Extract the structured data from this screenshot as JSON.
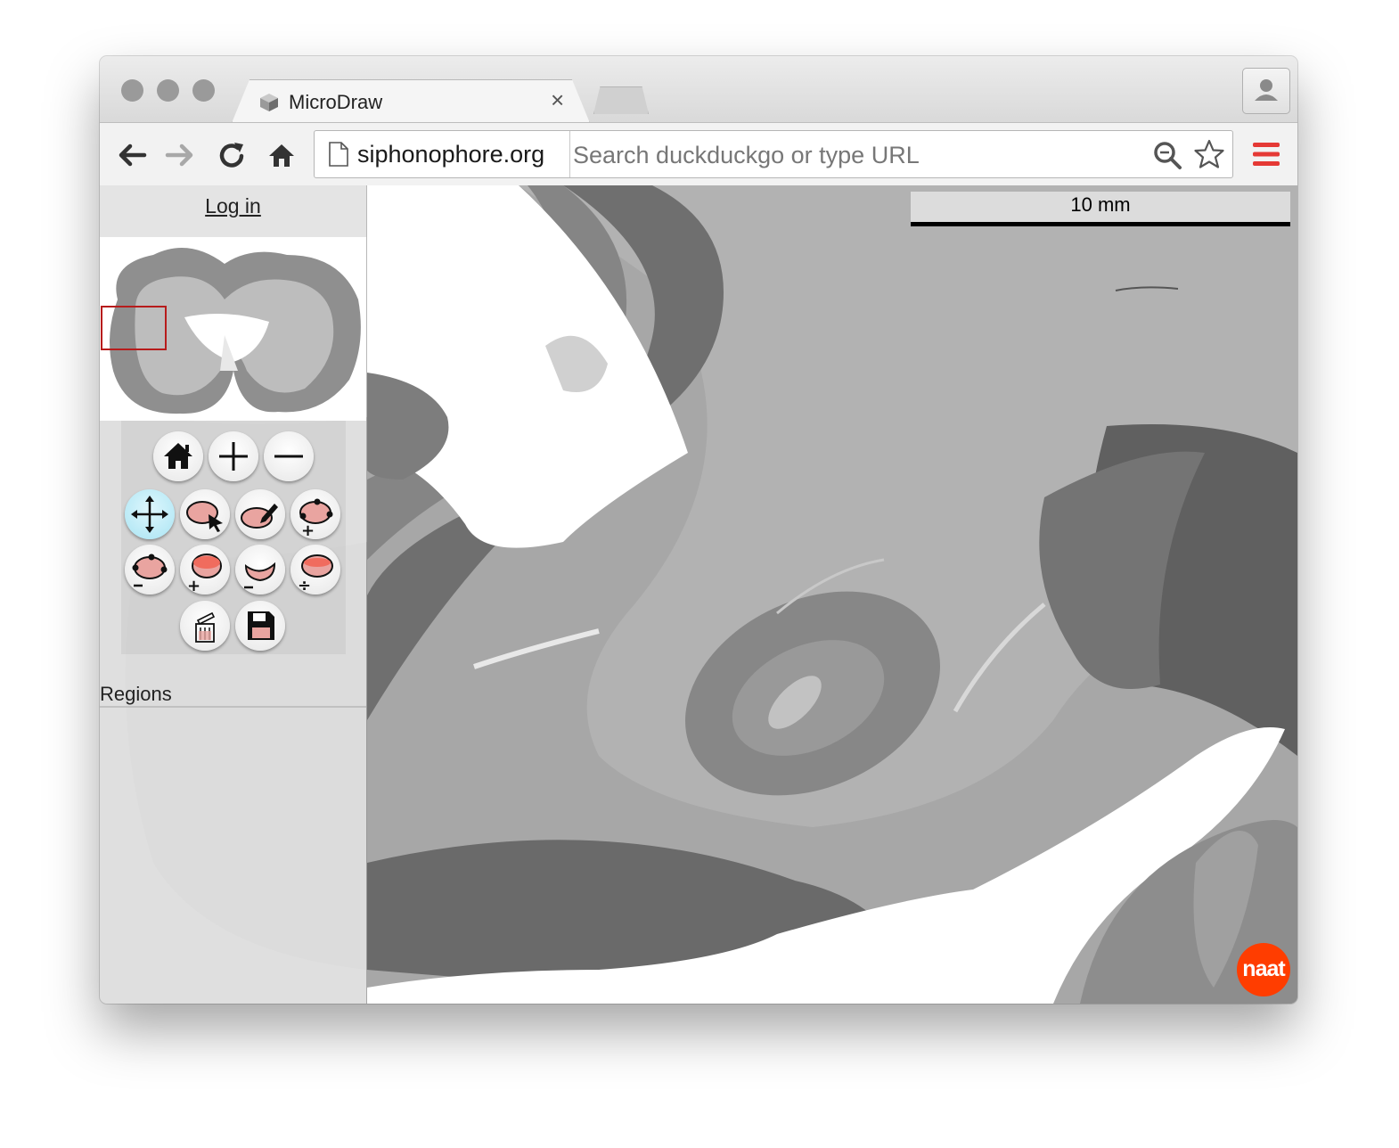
{
  "browser": {
    "tab_title": "MicroDraw",
    "tab_close": "×",
    "site_label": "siphonophore.org",
    "omnibox_placeholder": "Search duckduckgo or type URL"
  },
  "app": {
    "login_label": "Log in",
    "scale_label": "10 mm",
    "regions_label": "Regions",
    "badge_label": "naat"
  },
  "tools": {
    "navigation": [
      "home-icon",
      "zoom-in-icon",
      "zoom-out-icon"
    ],
    "editing": [
      "move-tool",
      "select-region-tool",
      "draw-tool",
      "add-point-tool",
      "delete-point-tool",
      "add-region-tool",
      "subtract-region-tool",
      "split-region-tool"
    ],
    "actions": [
      "delete-icon",
      "save-icon"
    ],
    "selected": "move-tool"
  },
  "colors": {
    "accent_red": "#e53935",
    "badge": "#ff3d00",
    "selected_tool": "#a9e4f3",
    "region_fill": "#e9a4a0"
  }
}
